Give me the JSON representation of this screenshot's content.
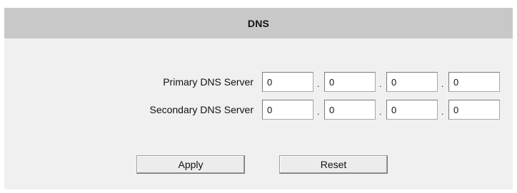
{
  "header": {
    "title": "DNS"
  },
  "form": {
    "primary": {
      "label": "Primary DNS Server",
      "octets": [
        "0",
        "0",
        "0",
        "0"
      ]
    },
    "secondary": {
      "label": "Secondary DNS Server",
      "octets": [
        "0",
        "0",
        "0",
        "0"
      ]
    },
    "separator": "."
  },
  "actions": {
    "apply_label": "Apply",
    "reset_label": "Reset"
  }
}
